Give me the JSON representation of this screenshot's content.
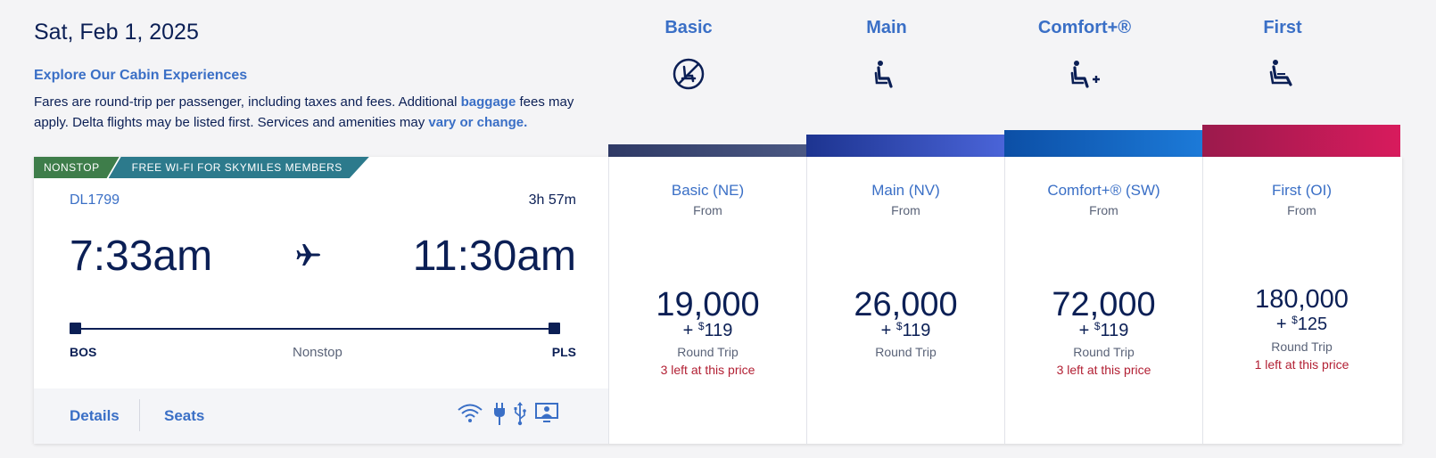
{
  "header": {
    "date": "Sat, Feb 1, 2025",
    "explore_title": "Explore Our Cabin Experiences",
    "disclaimer_1": "Fares are round-trip per passenger, including taxes and fees. Additional ",
    "baggage_link": "baggage",
    "disclaimer_2": " fees may apply. Delta flights may be listed first. Services and amenities may ",
    "change_link": "vary or change."
  },
  "cabins": [
    {
      "name": "Basic",
      "icon": "no-seat-icon"
    },
    {
      "name": "Main",
      "icon": "seat-icon"
    },
    {
      "name": "Comfort+®",
      "icon": "seat-plus-icon"
    },
    {
      "name": "First",
      "icon": "premium-seat-icon"
    }
  ],
  "flight": {
    "badge_nonstop": "NONSTOP",
    "badge_wifi": "FREE WI-FI FOR SKYMILES MEMBERS",
    "number": "DL1799",
    "duration": "3h 57m",
    "depart_time": "7:33am",
    "arrive_time": "11:30am",
    "origin": "BOS",
    "destination": "PLS",
    "stops": "Nonstop",
    "details_label": "Details",
    "seats_label": "Seats",
    "amenities": [
      "wifi-icon",
      "power-outlet-icon",
      "usb-icon",
      "entertainment-screen-icon"
    ]
  },
  "fares": [
    {
      "name": "Basic (NE)",
      "from": "From",
      "miles": "19,000",
      "plus": "+",
      "currency": "$",
      "cash": "119",
      "trip": "Round Trip",
      "availability": "3 left at this price",
      "color_start": "#2f3a66",
      "color_end": "#4b5883"
    },
    {
      "name": "Main (NV)",
      "from": "From",
      "miles": "26,000",
      "plus": "+",
      "currency": "$",
      "cash": "119",
      "trip": "Round Trip",
      "availability": "",
      "color_start": "#1d3490",
      "color_end": "#4a64d8"
    },
    {
      "name": "Comfort+® (SW)",
      "from": "From",
      "miles": "72,000",
      "plus": "+",
      "currency": "$",
      "cash": "119",
      "trip": "Round Trip",
      "availability": "3 left at this price",
      "color_start": "#0c4fa6",
      "color_end": "#1c7ad8"
    },
    {
      "name": "First (OI)",
      "from": "From",
      "miles": "180,000",
      "plus": "+",
      "currency": "$",
      "cash": "125",
      "trip": "Round Trip",
      "availability": "1 left at this price",
      "color_start": "#9b1a4c",
      "color_end": "#d81b5d"
    }
  ]
}
